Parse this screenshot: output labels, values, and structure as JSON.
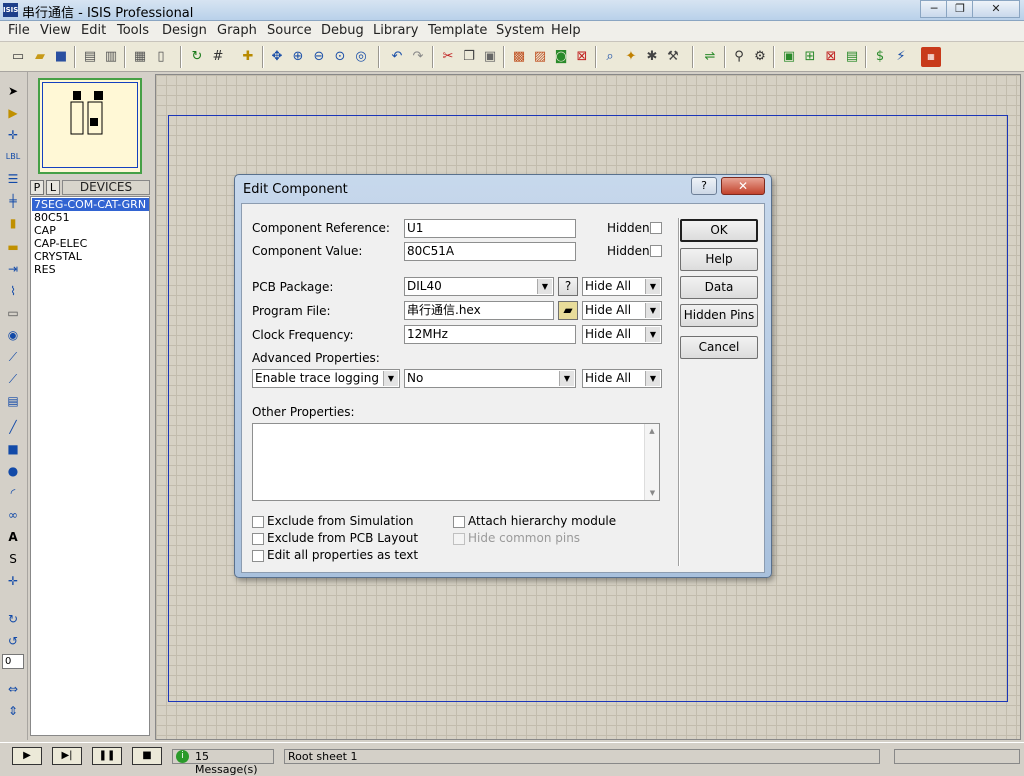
{
  "window": {
    "title": "串行通信 - ISIS Professional",
    "app_icon": "ISIS",
    "minimize": "─",
    "restore": "❐",
    "close": "✕"
  },
  "menu": [
    "File",
    "View",
    "Edit",
    "Tools",
    "Design",
    "Graph",
    "Source",
    "Debug",
    "Library",
    "Template",
    "System",
    "Help"
  ],
  "toolbar": {
    "icons": [
      "new-icon",
      "open-icon",
      "save-icon",
      "import-icon",
      "export-icon",
      "print-icon",
      "print-area-icon",
      "refresh-icon",
      "grid-icon",
      "origin-icon",
      "pan-icon",
      "zoom-in-icon",
      "zoom-out-icon",
      "zoom-all-icon",
      "zoom-area-icon",
      "undo-icon",
      "redo-icon",
      "cut-icon",
      "copy-icon",
      "paste-icon",
      "block-copy-icon",
      "block-move-icon",
      "block-rotate-icon",
      "block-delete-icon",
      "pick-device-icon",
      "make-device-icon",
      "package-tool-icon",
      "decompose-icon",
      "wire-autorouter-icon",
      "search-icon",
      "property-tool-icon",
      "new-sheet-icon",
      "remove-sheet-icon",
      "exit-to-parent-icon",
      "bom-icon",
      "erc-icon",
      "netlist-to-ares-icon"
    ]
  },
  "left_tools": {
    "angle_value": "0"
  },
  "device_panel": {
    "tab_p": "P",
    "tab_l": "L",
    "header": "DEVICES",
    "devices": [
      "7SEG-COM-CAT-GRN",
      "80C51",
      "CAP",
      "CAP-ELEC",
      "CRYSTAL",
      "RES"
    ],
    "selected_index": 0
  },
  "status": {
    "messages": "15 Message(s)",
    "sheet": "Root sheet 1"
  },
  "dialog": {
    "title": "Edit Component",
    "help_btn": "?",
    "close_btn": "✕",
    "component_reference": {
      "label": "Component Reference:",
      "value": "U1",
      "hidden_label": "Hidden:"
    },
    "component_value": {
      "label": "Component Value:",
      "value": "80C51A",
      "hidden_label": "Hidden:"
    },
    "pcb_package": {
      "label": "PCB Package:",
      "value": "DIL40",
      "q": "?",
      "vis": "Hide All"
    },
    "program_file": {
      "label": "Program File:",
      "value": "串行通信.hex",
      "vis": "Hide All"
    },
    "clock_frequency": {
      "label": "Clock Frequency:",
      "value": "12MHz",
      "vis": "Hide All"
    },
    "advanced": {
      "label": "Advanced Properties:",
      "property": "Enable trace logging",
      "value": "No",
      "vis": "Hide All"
    },
    "other_properties_label": "Other Properties:",
    "checks": {
      "exclude_sim": "Exclude from Simulation",
      "exclude_pcb": "Exclude from PCB Layout",
      "edit_all": "Edit all properties as text",
      "attach_hier": "Attach hierarchy module",
      "hide_pins": "Hide common pins"
    },
    "buttons": {
      "ok": "OK",
      "help": "Help",
      "data": "Data",
      "hidden_pins": "Hidden Pins",
      "cancel": "Cancel"
    }
  }
}
